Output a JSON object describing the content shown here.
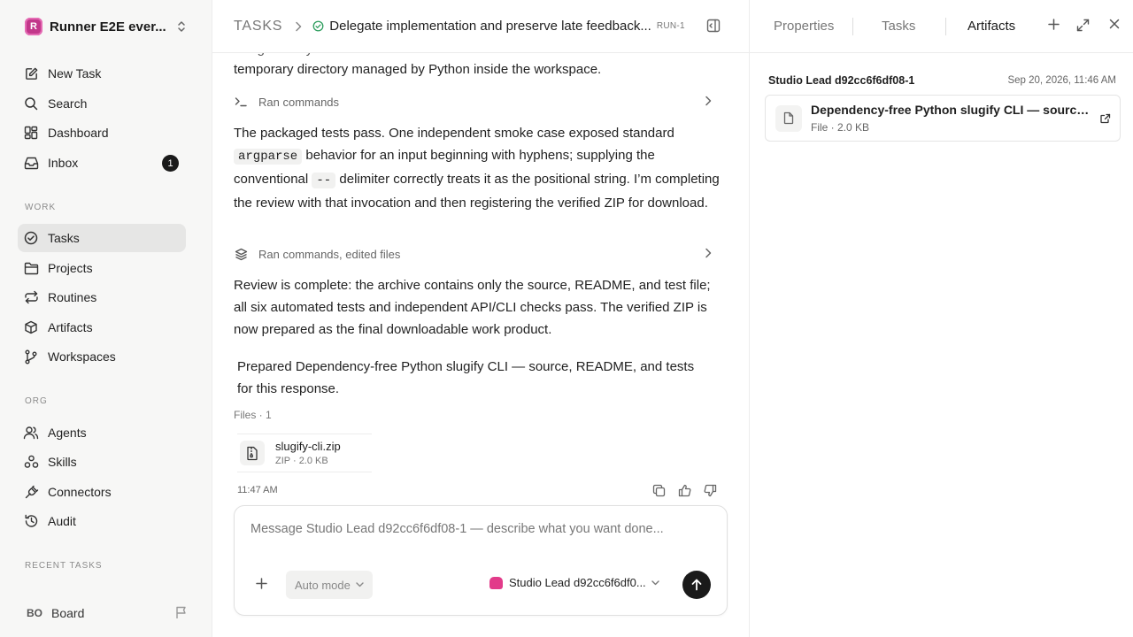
{
  "workspace": {
    "initial": "R",
    "name": "Runner E2E ever..."
  },
  "nav_main": [
    {
      "label": "New Task",
      "icon": "edit-icon"
    },
    {
      "label": "Search",
      "icon": "search-icon"
    },
    {
      "label": "Dashboard",
      "icon": "dashboard-icon"
    },
    {
      "label": "Inbox",
      "icon": "inbox-icon",
      "badge": "1"
    }
  ],
  "sections": {
    "work": "WORK",
    "org": "ORG",
    "recent": "RECENT TASKS"
  },
  "nav_work": [
    {
      "label": "Tasks",
      "icon": "check-circle-icon",
      "active": true
    },
    {
      "label": "Projects",
      "icon": "folder-icon"
    },
    {
      "label": "Routines",
      "icon": "repeat-icon"
    },
    {
      "label": "Artifacts",
      "icon": "box-icon"
    },
    {
      "label": "Workspaces",
      "icon": "branch-icon"
    }
  ],
  "nav_org": [
    {
      "label": "Agents",
      "icon": "users-icon"
    },
    {
      "label": "Skills",
      "icon": "skills-icon"
    },
    {
      "label": "Connectors",
      "icon": "plug-icon"
    },
    {
      "label": "Audit",
      "icon": "history-icon"
    }
  ],
  "user": {
    "initials": "BO",
    "name": "Board"
  },
  "header": {
    "root": "TASKS",
    "title": "Delegate implementation and preserve late feedback...",
    "run_id": "RUN-1"
  },
  "chat": {
    "para0_line1": "…ing …  …by …  … …",
    "para0_line2": "temporary directory managed by Python inside the workspace.",
    "step1": "Ran commands",
    "para1": {
      "t1": "The packaged tests pass. One independent smoke case exposed standard",
      "code1": "argparse",
      "t2": " behavior for an input beginning with hyphens; supplying the conventional ",
      "code2": "--",
      "t3": " delimiter correctly treats it as the positional string. I’m completing the review with that invocation and then registering the verified ZIP for download."
    },
    "step2": "Ran commands, edited files",
    "para2": "Review is complete: the archive contains only the source, README, and test file; all six automated tests and independent API/CLI checks pass. The verified ZIP is now prepared as the final downloadable work product.",
    "para3": "Prepared Dependency-free Python slugify CLI — source, README, and tests for this response.",
    "files_label": "Files · 1",
    "file": {
      "name": "slugify-cli.zip",
      "meta": "ZIP · 2.0 KB"
    },
    "time": "11:47 AM"
  },
  "composer": {
    "placeholder": "Message Studio Lead d92cc6f6df08-1 — describe what you want done...",
    "mode": "Auto mode",
    "agent": "Studio Lead d92cc6f6df0..."
  },
  "right_panel": {
    "tabs": [
      "Properties",
      "Tasks",
      "Artifacts"
    ],
    "active_tab": "Artifacts",
    "artifact_owner": "Studio Lead d92cc6f6df08-1",
    "artifact_date": "Sep 20, 2026, 11:46 AM",
    "artifact_title": "Dependency-free Python slugify CLI — source, README, and tests",
    "artifact_meta": "File · 2.0 KB"
  }
}
